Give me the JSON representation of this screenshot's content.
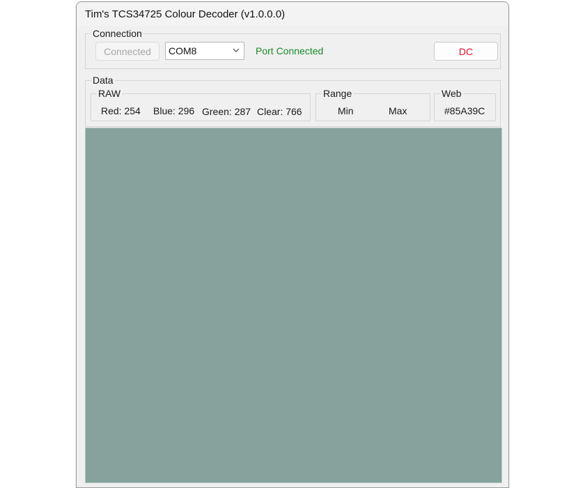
{
  "window": {
    "title": "Tim's TCS34725 Colour Decoder (v1.0.0.0)"
  },
  "connection": {
    "legend": "Connection",
    "connect_button_label": "Connected",
    "port_selected": "COM8",
    "status_text": "Port Connected",
    "status_color": "#1a8a28",
    "dc_button_label": "DC",
    "dc_button_color": "#e81123"
  },
  "data": {
    "legend": "Data",
    "raw": {
      "legend": "RAW",
      "red": "Red: 254",
      "blue": "Blue: 296",
      "green": "Green: 287",
      "clear": "Clear: 766"
    },
    "range": {
      "legend": "Range",
      "min_label": "Min",
      "max_label": "Max"
    },
    "web": {
      "legend": "Web",
      "hex": "#85A39C"
    }
  },
  "swatch": {
    "color": "#85A39C",
    "icon": "color-swatch"
  }
}
